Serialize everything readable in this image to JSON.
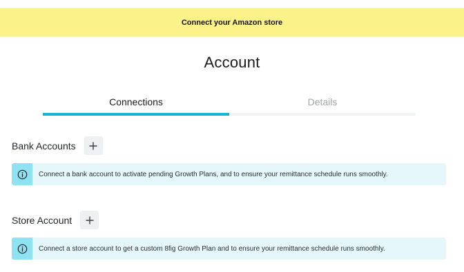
{
  "banner": {
    "text": "Connect your Amazon store"
  },
  "page": {
    "title": "Account"
  },
  "tabs": [
    {
      "label": "Connections",
      "active": true
    },
    {
      "label": "Details",
      "active": false
    }
  ],
  "bank_section": {
    "title": "Bank Accounts",
    "add_icon": "plus-icon",
    "info_icon": "info-circle-icon",
    "info_text": "Connect a bank account to activate pending Growth Plans, and to ensure your remittance schedule runs smoothly."
  },
  "store_section": {
    "title": "Store Account",
    "add_icon": "plus-icon",
    "info_icon": "info-circle-icon",
    "info_text": "Connect a store account to get a custom 8fig Growth Plan and to ensure your remittance schedule runs smoothly."
  },
  "colors": {
    "banner_bg": "#fbf28a",
    "accent": "#12b6d3",
    "info_bg": "#e6f7fb",
    "info_icon_bg": "#8fe2f1"
  }
}
